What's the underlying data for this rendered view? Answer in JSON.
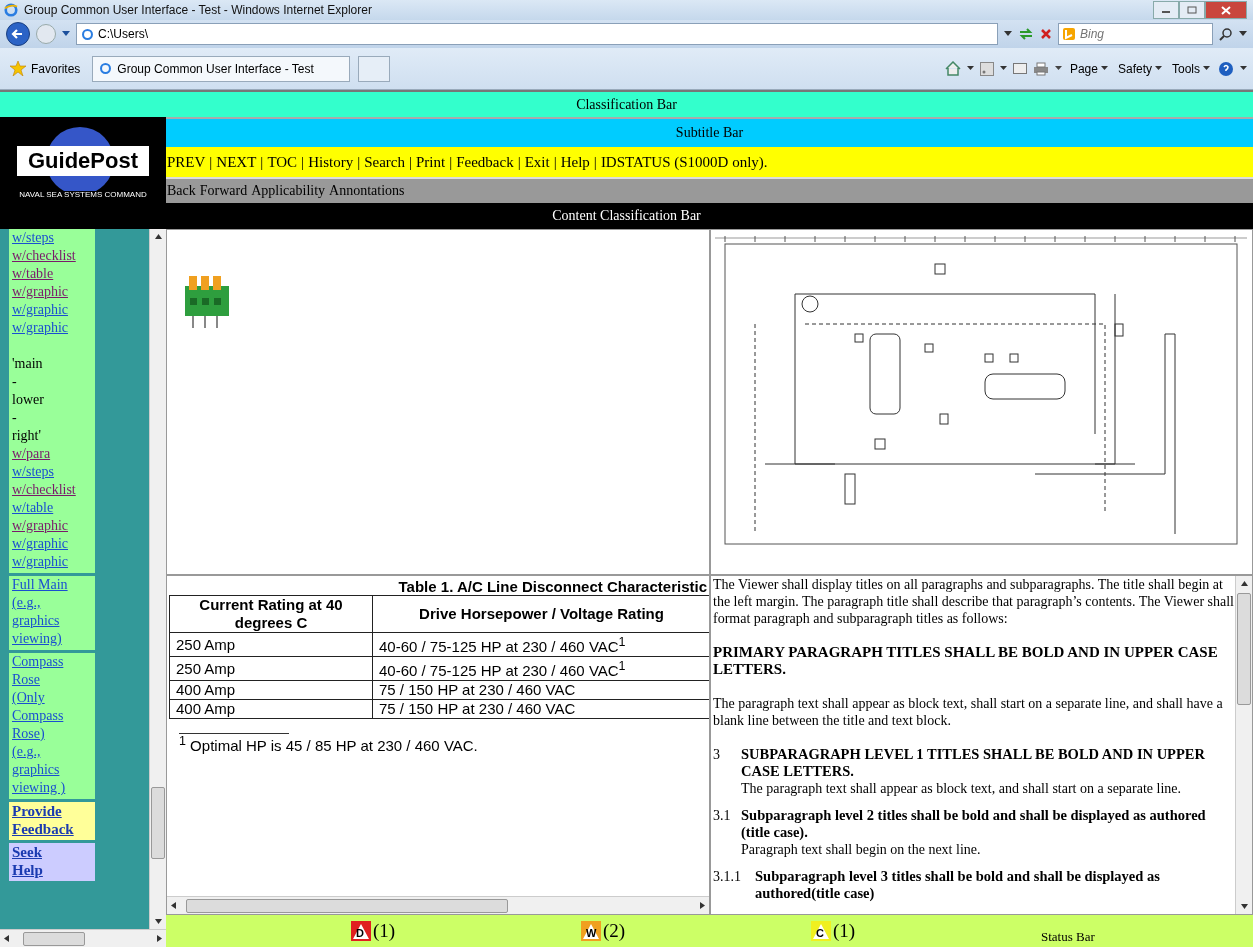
{
  "browser": {
    "title": "Group Common User Interface - Test - Windows Internet Explorer",
    "address": "C:\\Users\\",
    "search_placeholder": "Bing",
    "favorites": "Favorites",
    "tab": "Group Common User Interface - Test",
    "commands": [
      "Page",
      "Safety",
      "Tools"
    ]
  },
  "classification_bar": "Classification Bar",
  "logo": {
    "title": "GuidePost",
    "subtitle": "NAVAL SEA SYSTEMS COMMAND"
  },
  "subtitle_bar": "Subtitle Bar",
  "nav_bar": {
    "separator": "|",
    "items": [
      "PREV",
      "NEXT",
      "TOC",
      "History",
      "Search",
      "Print",
      "Feedback",
      "Exit",
      "Help",
      "IDSTATUS (S1000D only)."
    ]
  },
  "tool_bar": [
    "Back",
    "Forward",
    "Applicability",
    "Annontations"
  ],
  "content_classification_bar": "Content Classification Bar",
  "sidebar": {
    "sections": [
      {
        "kind": "list",
        "color": "#99ff99",
        "items": [
          {
            "kind": "link",
            "text": "w/steps",
            "visited": false
          },
          {
            "kind": "link",
            "text": "w/checklist",
            "visited": true
          },
          {
            "kind": "link",
            "text": "w/table",
            "visited": true
          },
          {
            "kind": "link",
            "text": "w/graphic",
            "visited": true
          },
          {
            "kind": "link",
            "text": "w/graphic",
            "visited": false
          },
          {
            "kind": "link",
            "text": "w/graphic",
            "visited": false
          },
          {
            "kind": "gap"
          },
          {
            "kind": "text",
            "text": "'main"
          },
          {
            "kind": "text",
            "text": "-"
          },
          {
            "kind": "text",
            "text": "lower"
          },
          {
            "kind": "text",
            "text": "-"
          },
          {
            "kind": "text",
            "text": "right'"
          },
          {
            "kind": "link",
            "text": "w/para",
            "visited": true
          },
          {
            "kind": "link",
            "text": "w/steps",
            "visited": false
          },
          {
            "kind": "link",
            "text": "w/checklist",
            "visited": true
          },
          {
            "kind": "link",
            "text": "w/table",
            "visited": false
          },
          {
            "kind": "link",
            "text": "w/graphic",
            "visited": true
          },
          {
            "kind": "link",
            "text": "w/graphic",
            "visited": false
          },
          {
            "kind": "link",
            "text": "w/graphic",
            "visited": false
          }
        ]
      },
      {
        "kind": "block",
        "color": "#99ff99",
        "bold": false,
        "text": "Full Main (e.g., graphics viewing)"
      },
      {
        "kind": "block",
        "color": "#99ff99",
        "bold": false,
        "text": "Compass Rose (Only Compass Rose) (e.g., graphics viewing )"
      },
      {
        "kind": "block",
        "color": "#ffff99",
        "bold": true,
        "text": "Provide Feedback"
      },
      {
        "kind": "block",
        "color": "#ccccff",
        "bold": true,
        "text": "Seek Help"
      }
    ]
  },
  "table": {
    "title": "Table 1.  A/C Line Disconnect Characteristic",
    "columns": [
      "Current Rating at 40 degrees C",
      "Drive Horsepower / Voltage Rating"
    ],
    "rows": [
      [
        "250 Amp",
        "40-60 / 75-125 HP at 230 / 460 VAC$^{1}$"
      ],
      [
        "250 Amp",
        "40-60 / 75-125 HP at 230 / 460 VAC$^{1}$"
      ],
      [
        "400 Amp",
        "75 / 150 HP at 230 / 460 VAC"
      ],
      [
        "400 Amp",
        "75 / 150 HP at 230 / 460 VAC"
      ]
    ],
    "footnote": "$^{1}$ Optimal HP is 45 / 85 HP at 230 / 460 VAC."
  },
  "document": [
    {
      "kind": "para",
      "text": "The Viewer shall display titles on all paragraphs and subparagraphs. The title shall begin at the left margin. The paragraph title shall describe that paragraph’s contents.  The Viewer shall format paragraph and subparagraph titles as follows:"
    },
    {
      "kind": "title",
      "text": "PRIMARY PARAGRAPH TITLES SHALL BE BOLD AND IN UPPER CASE LETTERS."
    },
    {
      "kind": "para",
      "text": "The paragraph text shall appear as block text, shall start on a separate line, and shall have a blank line between the title and text block."
    },
    {
      "kind": "sub",
      "number": "3",
      "title": "SUBPARAGRAPH LEVEL 1 TITLES SHALL BE BOLD AND IN UPPER CASE LETTERS.",
      "body": "The paragraph text shall appear as block text, and shall start on a separate line."
    },
    {
      "kind": "sub",
      "number": "3.1",
      "title": "Subparagraph level 2 titles shall be bold and shall be displayed as authored (title case).",
      "body": "Paragraph text shall begin on the next line."
    },
    {
      "kind": "sub",
      "number": "3.1.1",
      "title": "Subparagraph level 3 titles shall be bold and shall be displayed as authored(title case)"
    }
  ],
  "status_bar": {
    "indicators": [
      {
        "letter": "D",
        "count": "(1)",
        "color": "#e02020"
      },
      {
        "letter": "W",
        "count": "(2)",
        "color": "#f0a020"
      },
      {
        "letter": "C",
        "count": "(1)",
        "color": "#f0f020"
      }
    ],
    "label": "Status Bar"
  }
}
